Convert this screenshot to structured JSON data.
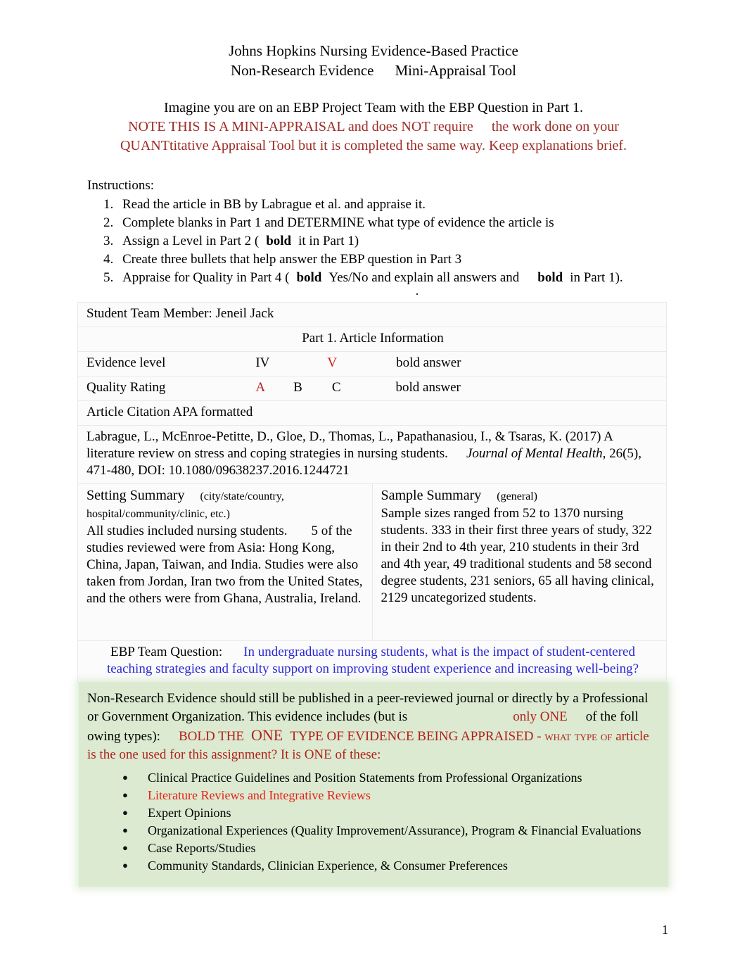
{
  "title": {
    "line1": "Johns Hopkins Nursing Evidence-Based Practice",
    "line2_a": "Non-Research Evidence",
    "line2_b": "Mini-Appraisal Tool"
  },
  "intro": {
    "line1": "Imagine you are on an EBP Project Team with the EBP Question in Part 1.",
    "red_a": "NOTE THIS IS A MINI-APPRAISAL and does NOT require",
    "red_b": "the work done on your",
    "red_c": "QUANTtitative Appraisal Tool but it is completed the same way. Keep explanations brief."
  },
  "instructions": {
    "heading": "Instructions:",
    "steps": [
      {
        "pre": "Read the article in BB by Labrague et al. and appraise it.",
        "bold": "",
        "post": ""
      },
      {
        "pre": "Complete blanks in Part 1 and DETERMINE what type of evidence the article is",
        "bold": "",
        "post": ""
      },
      {
        "pre": "Assign a Level in Part 2 (",
        "bold": "bold",
        "post": "it in Part 1)"
      },
      {
        "pre": "Create three bullets that help answer the EBP question in Part 3",
        "bold": "",
        "post": ""
      },
      {
        "pre": "Appraise for Quality in Part 4 (",
        "bold": "bold",
        "post": "Yes/No and explain all answers and",
        "bold2": "bold",
        "post2": "in Part 1)."
      }
    ],
    "mid_dot": "."
  },
  "form": {
    "student_row": "Student Team Member: Jeneil Jack",
    "part_header": "Part 1. Article Information",
    "evidence_level": {
      "label": "Evidence level",
      "option1": "IV",
      "option2": "V",
      "hint": "bold answer"
    },
    "quality_rating": {
      "label": "Quality Rating",
      "option1": "A",
      "option2": "B",
      "option3": "C",
      "hint": "bold answer"
    },
    "citation": {
      "label": "Article Citation APA formatted",
      "text_a": "Labrague, L., McEnroe-Petitte, D., Gloe, D., Thomas, L., Papathanasiou, I., & Tsaras, K. (2017) A literature review on stress and coping strategies in nursing students.",
      "journal": "Journal of Mental Health,",
      "text_b": "26(5), 471-480, DOI: 10.1080/09638237.2016.1244721"
    },
    "setting": {
      "title": "Setting Summary",
      "note": "(city/state/country, hospital/community/clinic, etc.)",
      "body_a": "All studies included nursing students.",
      "body_b": "5 of the studies reviewed were from Asia: Hong Kong, China, Japan, Taiwan, and India. Studies were also taken from Jordan, Iran two from the United States, and the others were from Ghana, Australia, Ireland."
    },
    "sample": {
      "title": "Sample Summary",
      "note": "(general)",
      "body": "Sample sizes ranged from 52 to 1370 nursing students. 333 in their first three years of study, 322 in their 2nd to 4th year, 210 students in their 3rd and 4th year, 49 traditional students and 58 second degree students, 231 seniors, 65 all having clinical, 2129 uncategorized students."
    },
    "ebp_question": {
      "label": "EBP Team Question:",
      "text": "In undergraduate nursing students, what is the impact of student-centered teaching strategies and faculty support on improving student experience and increasing well-being?"
    }
  },
  "green_panel": {
    "para_a": "Non-Research Evidence should still be published in a peer-reviewed journal or directly by a Professional or Government Organization. This evidence includes (but is",
    "only_one": "only ONE",
    "para_b": "of",
    "para_c": "the foll",
    "para_d": "owing types):",
    "bold_the": "BOLD THE",
    "one_big": "ONE",
    "caps_rest": "TYPE OF EVIDENCE BEING APPRAISED - what type of",
    "para_e": "article is the one used for this assignment? It is ONE of these:",
    "items": [
      {
        "text": "Clinical Practice Guidelines and Position Statements from Professional Organizations",
        "highlight": false
      },
      {
        "text": "Literature Reviews and Integrative Reviews",
        "highlight": true
      },
      {
        "text": "Expert Opinions",
        "highlight": false
      },
      {
        "text": "Organizational Experiences (Quality Improvement/Assurance), Program & Financial Evaluations",
        "highlight": false
      },
      {
        "text": "Case Reports/Studies",
        "highlight": false
      },
      {
        "text": "Community Standards, Clinician Experience, & Consumer Preferences",
        "highlight": false
      }
    ]
  },
  "footer": {
    "page_number": "1"
  },
  "colors": {
    "red_intro": "#9e2a24",
    "red_accent": "#b3201a",
    "red_bright": "#e8211a",
    "blue_question": "#2a27d6",
    "green_header": "#93c482",
    "green_panel": "#dbead0"
  }
}
